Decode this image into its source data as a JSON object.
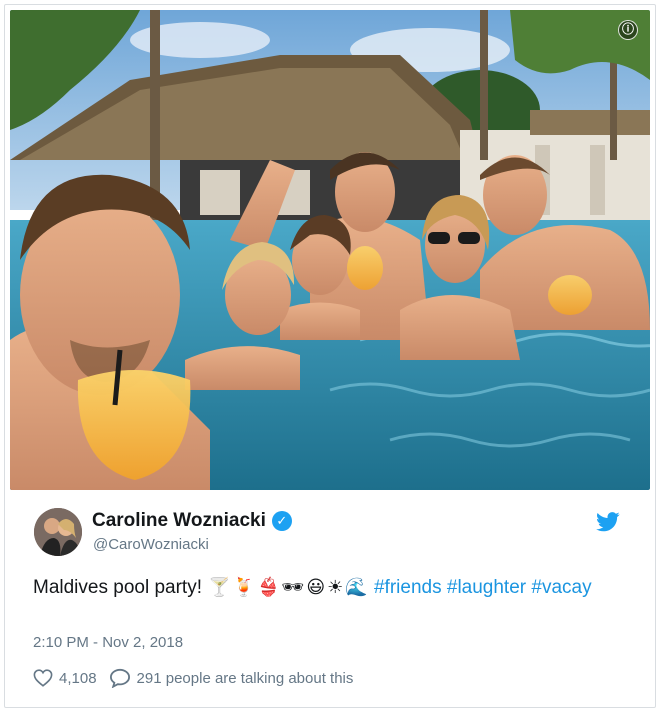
{
  "author": {
    "display_name": "Caroline Wozniacki",
    "handle": "@CaroWozniacki",
    "verified": true
  },
  "tweet": {
    "text_main": "Maldives pool party!",
    "emojis": [
      {
        "name": "cocktail-glass-icon",
        "glyph": "🍸"
      },
      {
        "name": "tropical-drink-icon",
        "glyph": "🍹"
      },
      {
        "name": "bikini-icon",
        "glyph": "👙"
      },
      {
        "name": "sunglasses-icon",
        "glyph": "🕶"
      },
      {
        "name": "smiley-icon",
        "glyph": "😃"
      },
      {
        "name": "sun-icon",
        "glyph": "☀"
      },
      {
        "name": "wave-icon",
        "glyph": "🌊"
      }
    ],
    "hashtags": [
      "#friends",
      "#laughter",
      "#vacay"
    ],
    "timestamp": "2:10 PM - Nov 2, 2018"
  },
  "stats": {
    "likes": "4,108",
    "talking": "291 people are talking about this"
  },
  "colors": {
    "link": "#1b95e0",
    "twitter_blue": "#1da1f2",
    "meta_gray": "#657786"
  },
  "photo": {
    "description_icon": "info-icon"
  }
}
